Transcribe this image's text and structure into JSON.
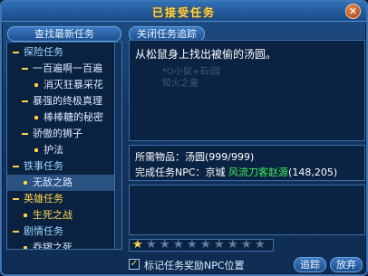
{
  "window": {
    "title": "已接受任务"
  },
  "toolbar": {
    "find_new_quest": "查找最新任务",
    "close_tracking": "关闭任务追踪"
  },
  "tree": {
    "items": [
      {
        "label": "探险任务",
        "kind": "cat"
      },
      {
        "label": "一百遍啊一百遍",
        "kind": "sub"
      },
      {
        "label": "消灭狂暴采花",
        "kind": "leaf"
      },
      {
        "label": "暴强的终极真理",
        "kind": "sub"
      },
      {
        "label": "棒棒糖的秘密",
        "kind": "leaf"
      },
      {
        "label": "骄傲的狮子",
        "kind": "sub"
      },
      {
        "label": "护法",
        "kind": "leaf"
      },
      {
        "label": "铁事任务",
        "kind": "cat"
      },
      {
        "label": "无敌之路",
        "kind": "leaf-selected"
      },
      {
        "label": "英雄任务",
        "kind": "cat-gold"
      },
      {
        "label": "生死之战",
        "kind": "leaf-gold"
      },
      {
        "label": "剧情任务",
        "kind": "cat"
      },
      {
        "label": "乔锣之死",
        "kind": "leaf"
      }
    ]
  },
  "quest": {
    "description": "从松鼠身上找出被偷的汤圆。",
    "watermark_line1": "*O小鼠+石i园",
    "watermark_line2": "知火之童"
  },
  "info": {
    "items_label": "所需物品：",
    "items_value": "汤圆(999/999)",
    "npc_label": "完成任务NPC：",
    "npc_city": "京城",
    "npc_name": "风流刀客赵源",
    "npc_coords": "(148,205)"
  },
  "difficulty": {
    "total": 10,
    "filled": 1
  },
  "footer": {
    "mark_npc": "标记任务奖励NPC位置",
    "mark_npc_checked": "✓",
    "track_button": "追踪",
    "abandon_button": "放弃"
  },
  "colors": {
    "accent_gold": "#ffd84d",
    "npc_green": "#3df05a"
  }
}
